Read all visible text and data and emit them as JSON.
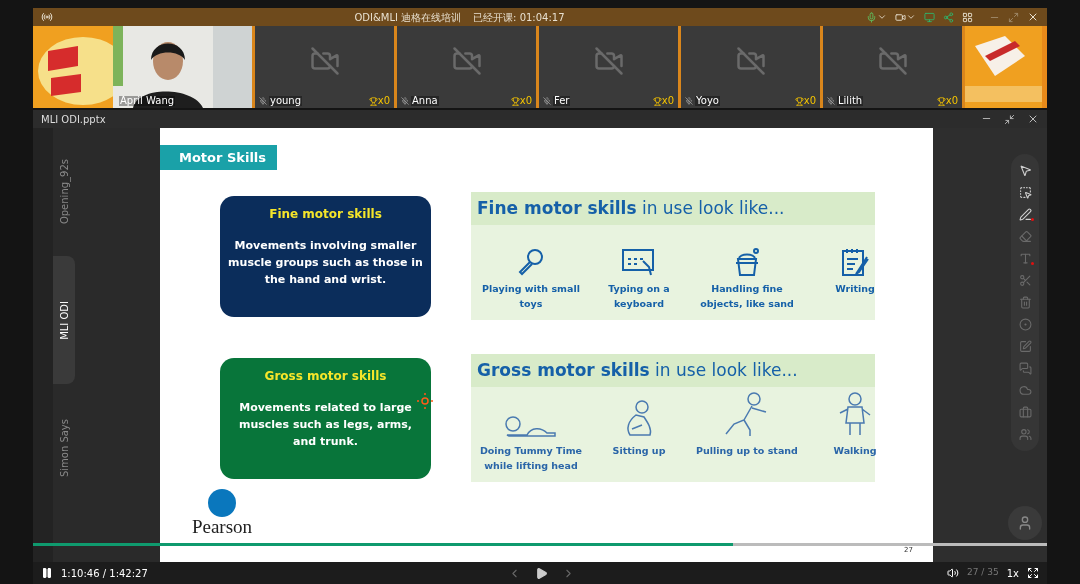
{
  "title_bar": {
    "title": "ODI&MLI 迪格在线培训",
    "elapsed": "已经开课: 01:04:17"
  },
  "participants": [
    {
      "name": "April Wang",
      "video": true
    },
    {
      "name": "young",
      "video": false,
      "trophies": "x0"
    },
    {
      "name": "Anna",
      "video": false,
      "trophies": "x0"
    },
    {
      "name": "Fer",
      "video": false,
      "trophies": "x0"
    },
    {
      "name": "Yoyo",
      "video": false,
      "trophies": "x0"
    },
    {
      "name": "Lilith",
      "video": false,
      "trophies": "x0"
    }
  ],
  "file_bar": {
    "title": "MLI ODI.pptx"
  },
  "sections": [
    {
      "label": "Opening_92s",
      "selected": false
    },
    {
      "label": "MLI ODI",
      "selected": true
    },
    {
      "label": "Simon Says",
      "selected": false
    }
  ],
  "slide": {
    "heading": "Motor Skills",
    "definitions": [
      {
        "title": "Fine motor skills",
        "text": "Movements involving smaller muscle groups such as those in the hand and wrist.",
        "color": "#0b2d5b"
      },
      {
        "title": "Gross motor skills",
        "text": "Movements related to large muscles such as legs, arms, and trunk.",
        "color": "#08753a"
      }
    ],
    "examples": [
      {
        "title": "**Fine motor skills** in use look like...",
        "items": [
          "Playing with small toys",
          "Typing on a keyboard",
          "Handling fine objects, like sand",
          "Writing"
        ]
      },
      {
        "title": "**Gross motor skills** in use look like...",
        "items": [
          "Doing Tummy Time while lifting head",
          "Sitting up",
          "Pulling up to stand",
          "Walking"
        ]
      }
    ],
    "logo": "Pearson",
    "page_number": "27"
  },
  "player": {
    "playing": true,
    "level": 0.69,
    "time": "1:10:46 / 1:42:27",
    "speed": "1x",
    "page": "27 / 35"
  }
}
